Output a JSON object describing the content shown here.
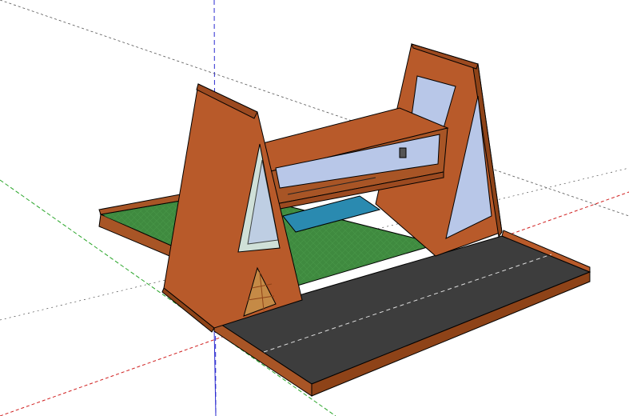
{
  "app": {
    "name": ""
  },
  "viewport": {
    "background": "#ffffff",
    "axes": {
      "red": "#d02020",
      "green": "#2aa62a",
      "blue": "#2a2ad0"
    }
  },
  "model": {
    "colors": {
      "wood": "#b85a2a",
      "wood_dark": "#9c4a20",
      "wood_shadow": "#8e4318",
      "glass": "#b8c7e8",
      "glass_light": "#cfe0d8",
      "grass": "#3f8a3f",
      "pool": "#2a8ab0",
      "road": "#3d3d3d",
      "outline": "#000000",
      "door": "#c58a46"
    },
    "parts": [
      "left-a-frame",
      "right-a-frame",
      "connecting-bridge",
      "bridge-window",
      "grass-lawn",
      "pool",
      "road-slab",
      "front-door"
    ]
  }
}
